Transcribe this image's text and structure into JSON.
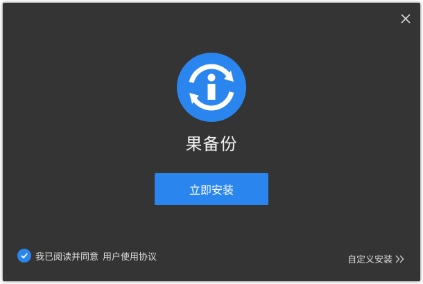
{
  "window": {
    "close_icon": "close-icon"
  },
  "app": {
    "logo_icon": "info-sync-icon",
    "name": "果备份"
  },
  "actions": {
    "install_label": "立即安装"
  },
  "footer": {
    "agree_checked": true,
    "agree_text": "我已阅读并同意",
    "agreement_link": "用户使用协议",
    "custom_install_label": "自定义安装",
    "custom_install_icon": "double-chevron-right-icon"
  },
  "colors": {
    "background": "#343434",
    "accent": "#2a86ee",
    "text": "#dcdcdc"
  }
}
